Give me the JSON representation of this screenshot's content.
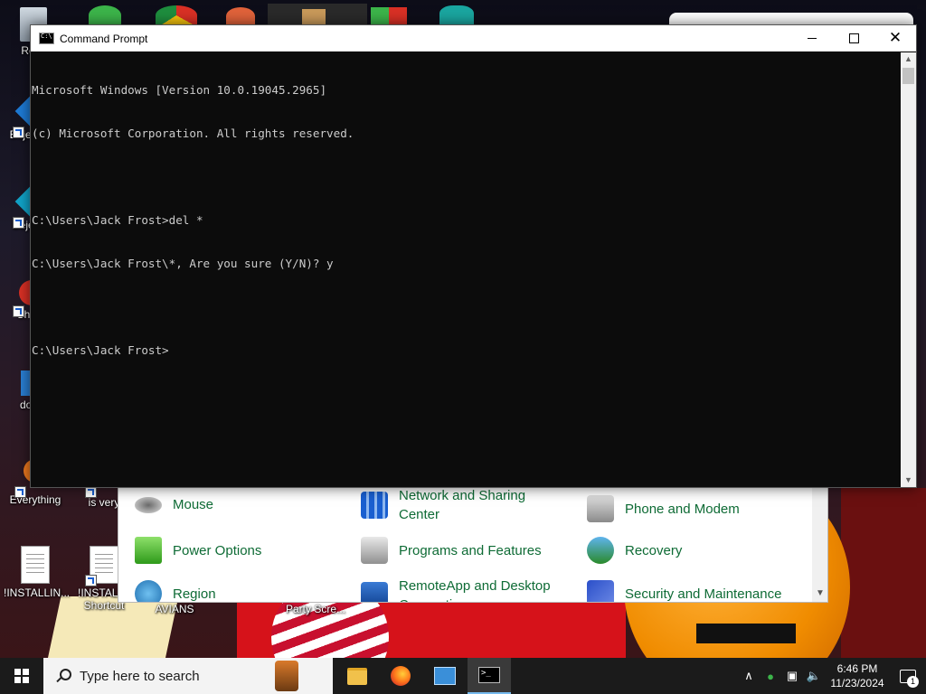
{
  "desktop": {
    "icons": [
      {
        "label": "Recy"
      },
      {
        "label": "Bejev De"
      },
      {
        "label": "Beje De"
      },
      {
        "label": "Ch De"
      },
      {
        "label": "does"
      },
      {
        "label": "Everything"
      },
      {
        "label": "is very"
      },
      {
        "label": "!INSTALLIN..."
      },
      {
        "label": "!INSTALL - Shortcut"
      },
      {
        "label": "AVIANS"
      },
      {
        "label": "Party Scre..."
      }
    ]
  },
  "cmd_window": {
    "title": "Command Prompt",
    "lines": [
      "Microsoft Windows [Version 10.0.19045.2965]",
      "(c) Microsoft Corporation. All rights reserved.",
      "",
      "C:\\Users\\Jack Frost>del *",
      "C:\\Users\\Jack Frost\\*, Are you sure (Y/N)? y",
      "",
      "C:\\Users\\Jack Frost>"
    ]
  },
  "control_panel": {
    "items": [
      {
        "label": "Mouse",
        "icon": "mouse-icon"
      },
      {
        "label": "Network and Sharing Center",
        "icon": "network-icon"
      },
      {
        "label": "Phone and Modem",
        "icon": "phone-icon"
      },
      {
        "label": "Power Options",
        "icon": "battery-icon"
      },
      {
        "label": "Programs and Features",
        "icon": "programs-icon"
      },
      {
        "label": "Recovery",
        "icon": "recovery-icon"
      },
      {
        "label": "Region",
        "icon": "globe-icon"
      },
      {
        "label": "RemoteApp and Desktop Connections",
        "icon": "remote-desktop-icon"
      },
      {
        "label": "Security and Maintenance",
        "icon": "flag-icon"
      }
    ]
  },
  "taskbar": {
    "search_placeholder": "Type here to search",
    "clock_time": "6:46 PM",
    "clock_date": "11/23/2024",
    "notification_count": "1"
  }
}
